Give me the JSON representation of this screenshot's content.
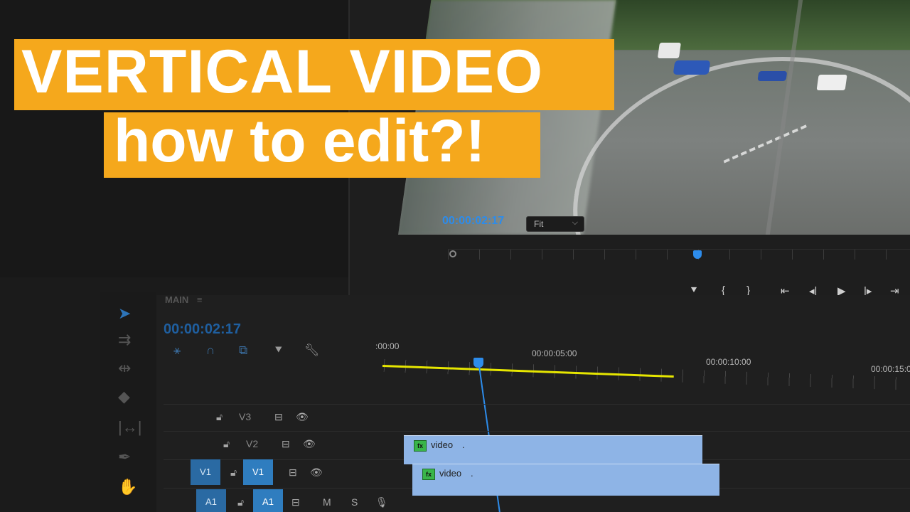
{
  "title": {
    "line1": "VERTICAL VIDEO",
    "line2": "how to edit?!"
  },
  "program_monitor": {
    "timecode": "00:00:02:17",
    "zoom_select": "Fit"
  },
  "timeline": {
    "sequence_name": "MAIN",
    "timecode": "00:00:02:17",
    "ruler_labels": [
      ":00:00",
      "00:00:05:00",
      "00:00:10:00",
      "00:00:15:0"
    ],
    "tracks": {
      "v3": "V3",
      "v2": "V2",
      "v1": "V1",
      "v1_source": "V1",
      "a1": "A1",
      "a1_source": "A1",
      "mute": "M",
      "solo": "S"
    },
    "clips": [
      {
        "name": "video",
        "fx": "fx",
        "dot": "."
      },
      {
        "name": "video",
        "fx": "fx",
        "dot": "."
      }
    ]
  },
  "colors": {
    "title_bg": "#f5a81c",
    "accent_blue": "#2d8ceb",
    "work_area": "#e6e600",
    "clip": "#8eb4e6"
  }
}
